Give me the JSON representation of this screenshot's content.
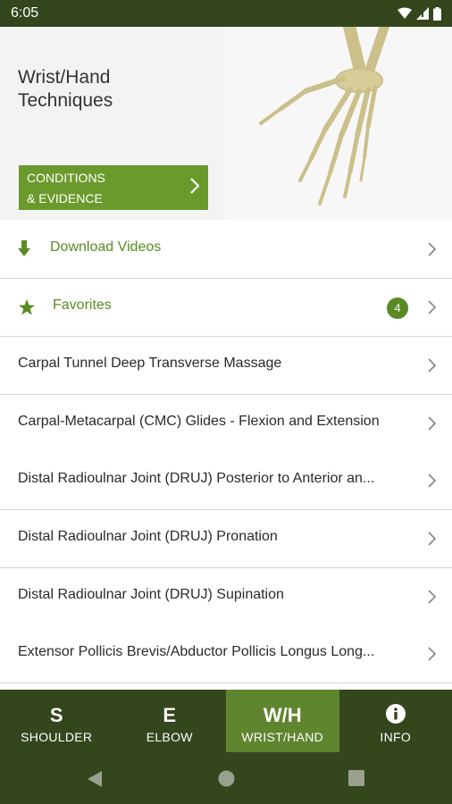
{
  "status_bar": {
    "time": "6:05"
  },
  "hero": {
    "title": "Wrist/Hand\nTechniques",
    "button_line1": "CONDITIONS",
    "button_line2": "& EVIDENCE"
  },
  "actions": [
    {
      "label": "Download Videos",
      "icon": "download-icon"
    },
    {
      "label": "Favorites",
      "icon": "star-icon",
      "badge": "4"
    }
  ],
  "techniques": [
    "Carpal Tunnel Deep Transverse Massage",
    "Carpal-Metacarpal (CMC) Glides  - Flexion and Extension",
    "Distal Radioulnar Joint (DRUJ) Posterior to Anterior an...",
    "Distal Radioulnar Joint (DRUJ) Pronation",
    "Distal Radioulnar Joint (DRUJ) Supination",
    "Extensor Pollicis Brevis/Abductor Pollicis Longus Long..."
  ],
  "tabs": [
    {
      "glyph": "S",
      "label": "SHOULDER"
    },
    {
      "glyph": "E",
      "label": "ELBOW"
    },
    {
      "glyph": "W/H",
      "label": "WRIST/HAND",
      "active": true
    },
    {
      "glyph": "i",
      "label": "INFO",
      "icon": "info-icon"
    }
  ],
  "colors": {
    "brand_dark": "#33461c",
    "brand_green": "#6a9a2c",
    "accent_text": "#5a8a25"
  }
}
